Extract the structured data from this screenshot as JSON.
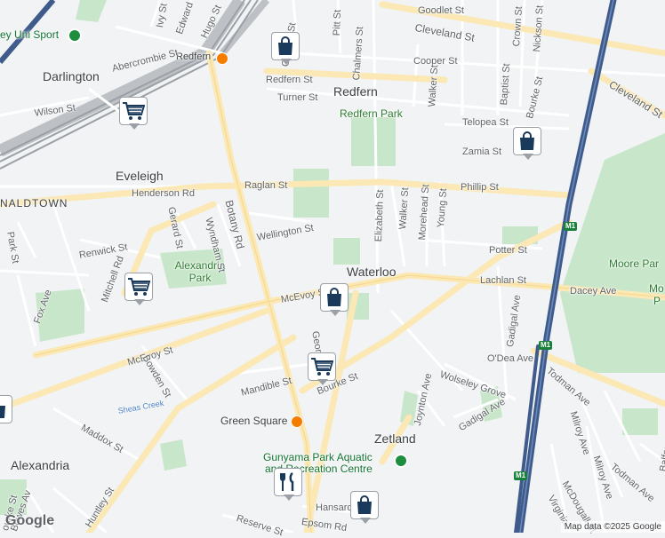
{
  "suburbs": {
    "darlington": "Darlington",
    "redfern": "Redfern",
    "eveleigh": "Eveleigh",
    "naldtown": "NALDTOWN",
    "waterloo": "Waterloo",
    "zetland": "Zetland",
    "alexandria": "Alexandria"
  },
  "parks": {
    "redfern_park": "Redfern Park",
    "alexandria_park": "Alexandria Park",
    "moore_park_1": "Moore Par",
    "moore_park_2": "Mo",
    "moore_park_3": "P"
  },
  "pois": {
    "uni_sport": "ey Uni Sport",
    "gunyama_line1": "Gunyama Park Aquatic",
    "gunyama_line2": "and Recreation Centre"
  },
  "stations": {
    "redfern": "Redfern",
    "green_square": "Green Square"
  },
  "streets": {
    "goodlet": "Goodlet St",
    "cleveland": "Cleveland St",
    "cleveland_east": "Cleveland St",
    "crown": "Crown St",
    "nickson": "Nickson St",
    "abercrombie": "Abercrombie St",
    "edward": "Edward",
    "ivy": "Ivy St",
    "hugo": "Hugo St",
    "pitt": "Pitt St",
    "chalmers": "Chalmers St",
    "george_top": "George St",
    "cooper": "Cooper St",
    "baptist": "Baptist St",
    "bourke_top": "Bourke St",
    "walker_top": "Walker St",
    "redfern_st": "Redfern St",
    "turner": "Turner St",
    "wilson": "Wilson St",
    "telopea": "Telopea St",
    "zamia": "Zamia St",
    "raglan": "Raglan St",
    "phillip": "Phillip St",
    "henderson": "Henderson Rd",
    "elizabeth": "Elizabeth St",
    "walker": "Walker St",
    "morehead": "Morehead St",
    "young": "Young St",
    "botany": "Botany Rd",
    "gerard": "Gerard St",
    "wyndham": "Wyndham St",
    "wellington": "Wellington St",
    "park": "Park St",
    "renwick": "Renwick St",
    "mitchell": "Mitchell Rd",
    "potter": "Potter St",
    "lachlan": "Lachlan St",
    "dacey": "Dacey Ave",
    "fox": "Fox Ave",
    "mcevoy_top": "McEvoy St",
    "mcevoy": "McEvoy St",
    "gadigal": "Gadigal Ave",
    "george": "George St",
    "odea": "O'Dea Ave",
    "bowden": "Bowden St",
    "mandible": "Mandible St",
    "bourke": "Bourke St",
    "wolseley": "Wolseley Grove",
    "todman": "Todman Ave",
    "todman2": "Todman Ave",
    "joynton": "Joynton Ave",
    "gadigal2": "Gadigal Ave",
    "milroy": "Milroy Ave",
    "milroy2": "Milroy Ave",
    "maddox": "Maddox St",
    "sheas": "Sheas Creek",
    "mcdougall": "McDougall St",
    "virginia": "Virginia",
    "balfour": "Balfour",
    "huntley": "Huntley St",
    "reserve": "Reserve St",
    "hansard": "Hansard",
    "epsom": "Epsom Rd",
    "bowes": "Bowes Av",
    "bourke2": "ourke St"
  },
  "motorway_shield": "M1",
  "marker_icons": {
    "shopping_bag": "shopping-bag-icon",
    "shopping_cart": "shopping-cart-icon",
    "restaurant": "restaurant-icon",
    "train_station": "train-station-icon"
  },
  "colors": {
    "park": "#c8e6c9",
    "motorway": "#3f5b8c",
    "major_road": "#fbe8b4",
    "marker_icon": "#1a3a5c",
    "station": "#f57c00"
  },
  "logo": "Google",
  "attribution": "Map data ©2025 Google"
}
